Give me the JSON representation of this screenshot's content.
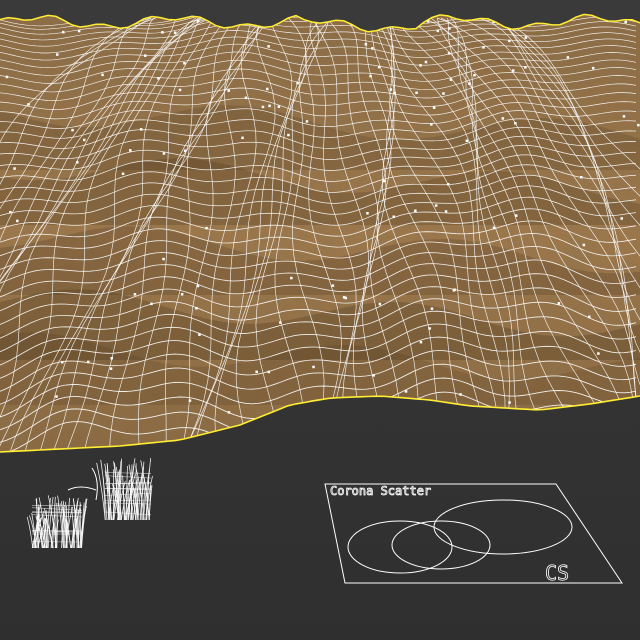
{
  "viewport": {
    "background": "#333333",
    "terrain": {
      "fill_light": "#a57f4f",
      "fill_dark": "#6a4d2c",
      "wire_color": "#ffffff",
      "selection_outline": "#ffee33"
    },
    "grass_object": {
      "icon": "grass-wireframe-icon"
    },
    "corona_scatter": {
      "title": "Corona Scatter",
      "logo": "CS"
    }
  }
}
